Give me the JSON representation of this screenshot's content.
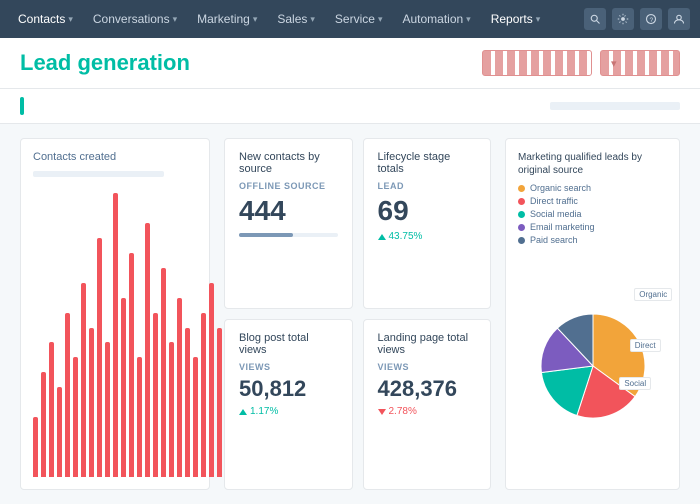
{
  "navbar": {
    "items": [
      {
        "label": "Contacts",
        "active": false
      },
      {
        "label": "Conversations",
        "active": false
      },
      {
        "label": "Marketing",
        "active": false
      },
      {
        "label": "Sales",
        "active": false
      },
      {
        "label": "Service",
        "active": false
      },
      {
        "label": "Automation",
        "active": false
      },
      {
        "label": "Reports",
        "active": true
      }
    ]
  },
  "page": {
    "title": "Lead generation",
    "btn_primary": "— — — — — —",
    "btn_secondary": "— — — —"
  },
  "stat_cards": [
    {
      "title": "New contacts by source",
      "label": "OFFLINE SOURCE",
      "value": "444",
      "change": "",
      "change_type": "neutral"
    },
    {
      "title": "Lifecycle stage totals",
      "label": "LEAD",
      "value": "69",
      "change": "43.75%",
      "change_type": "up"
    },
    {
      "title": "Blog post total views",
      "label": "VIEWS",
      "value": "50,812",
      "change": "1.17%",
      "change_type": "up"
    },
    {
      "title": "Landing page total views",
      "label": "VIEWS",
      "value": "428,376",
      "change": "2.78%",
      "change_type": "down"
    }
  ],
  "chart": {
    "title": "Contacts created",
    "bars": [
      20,
      35,
      45,
      30,
      55,
      40,
      65,
      50,
      80,
      45,
      95,
      60,
      75,
      40,
      85,
      55,
      70,
      45,
      60,
      50,
      40,
      55,
      65,
      50
    ]
  },
  "pie_chart": {
    "title": "Marketing qualified leads by original source",
    "segments": [
      {
        "label": "Organic search",
        "color": "#f2a43a",
        "value": 35
      },
      {
        "label": "Direct traffic",
        "color": "#f2545b",
        "value": 20
      },
      {
        "label": "Social media",
        "color": "#00bda5",
        "value": 18
      },
      {
        "label": "Email marketing",
        "color": "#7c5cbf",
        "value": 15
      },
      {
        "label": "Paid search",
        "color": "#516f90",
        "value": 12
      }
    ],
    "ext_labels": [
      {
        "text": "Organic",
        "top": "15%",
        "left": "78%"
      },
      {
        "text": "Direct",
        "top": "38%",
        "left": "75%"
      },
      {
        "text": "Social",
        "top": "55%",
        "left": "68%"
      }
    ]
  },
  "filter": {
    "range_label": ""
  }
}
